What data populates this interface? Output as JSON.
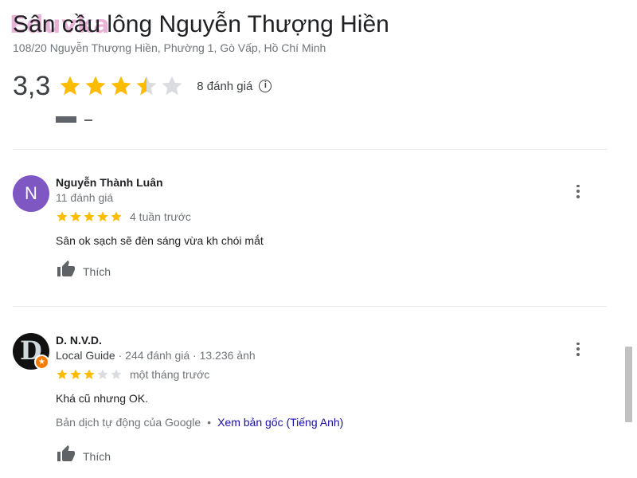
{
  "watermark": "Eduvka",
  "place": {
    "title": "Sân cầu lông Nguyễn Thượng Hiền",
    "address": "108/20 Nguyễn Thượng Hiền, Phường 1, Gò Vấp, Hồ Chí Minh",
    "rating": "3,3",
    "rating_stars": 3.5,
    "review_count": "8 đánh giá",
    "info": "i"
  },
  "reviews": [
    {
      "avatar_letter": "N",
      "avatar_color": "#7e57c2",
      "name": "Nguyễn Thành Luân",
      "meta": "11 đánh giá",
      "stars": 5,
      "time": "4 tuần trước",
      "text": "Sân ok sạch sẽ đèn sáng vừa kh chói mắt",
      "like_label": "Thích"
    },
    {
      "avatar_letter": "D",
      "avatar_color": "#111111",
      "name": "D. N.V.D.",
      "local_guide": "Local Guide",
      "dot": "·",
      "reviews_count": "244 đánh giá",
      "photos_count": "13.236 ảnh",
      "stars": 3,
      "time": "một tháng trước",
      "text": "Khá cũ nhưng OK.",
      "translation_note": "Bản dịch tự động của Google",
      "translation_sep": "•",
      "translation_link": "Xem bản gốc (Tiếng Anh)",
      "like_label": "Thích"
    }
  ],
  "colors": {
    "star_filled": "#fbbc04",
    "star_empty": "#dadce0",
    "link": "#1a0dab",
    "badge": "#f57c00"
  }
}
